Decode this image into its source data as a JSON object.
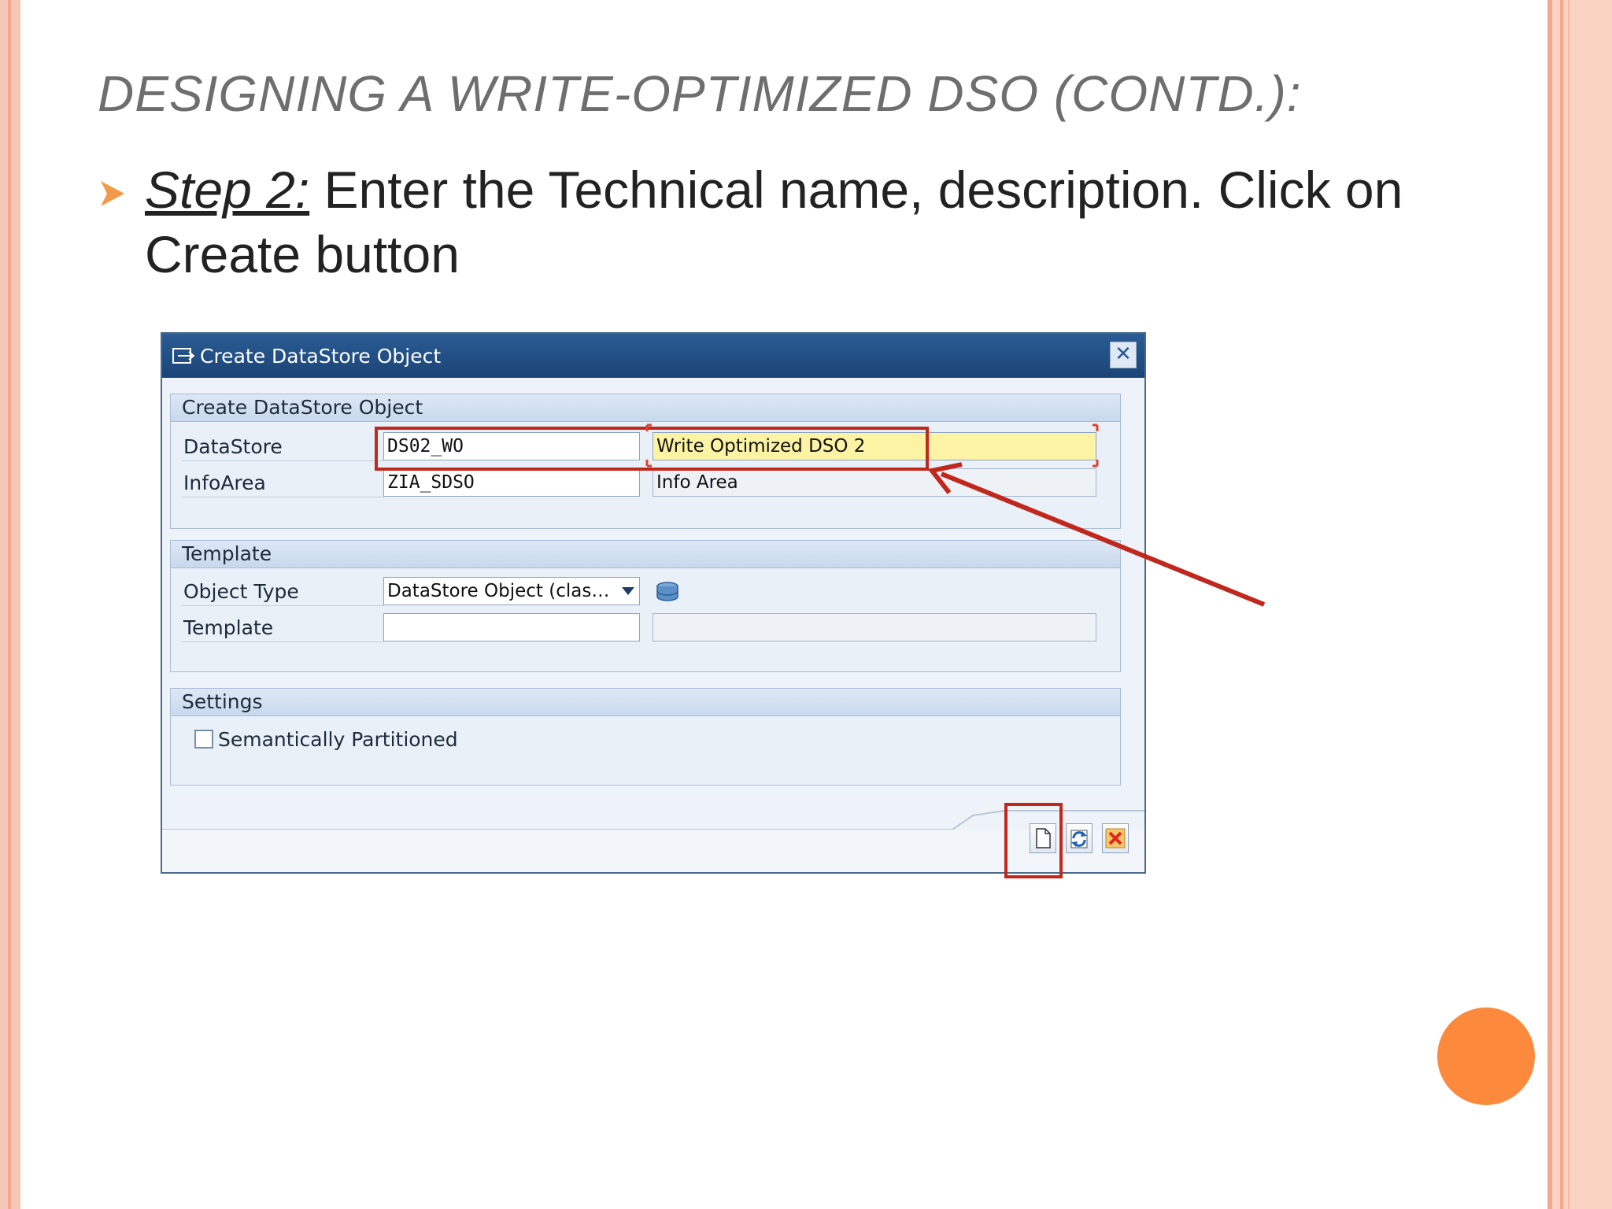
{
  "slide": {
    "title": "DESIGNING A WRITE-OPTIMIZED DSO (CONTD.):",
    "step_label": "Step 2:",
    "step_text": " Enter the Technical name, description. Click on Create button",
    "colors": {
      "accent": "#fd8a3c",
      "highlight": "#c0281d",
      "titlebar": "#1f4c80"
    }
  },
  "dialog": {
    "title": "Create DataStore Object",
    "close_icon": "close-icon",
    "groups": {
      "main": {
        "header": "Create DataStore Object",
        "datastore_label": "DataStore",
        "datastore_value": "DS02_WO",
        "description_value": "Write Optimized DSO 2",
        "infoarea_label": "InfoArea",
        "infoarea_value": "ZIA_SDSO",
        "infoarea_desc": "Info Area"
      },
      "template": {
        "header": "Template",
        "object_type_label": "Object Type",
        "object_type_value": "DataStore Object (clas…",
        "template_label": "Template",
        "template_value": "",
        "template_desc": ""
      },
      "settings": {
        "header": "Settings",
        "semantically_partitioned_label": "Semantically Partitioned",
        "semantically_partitioned_checked": false
      }
    },
    "buttons": {
      "create": "create-document-icon",
      "refresh": "refresh-icon",
      "cancel": "cancel-icon"
    }
  }
}
